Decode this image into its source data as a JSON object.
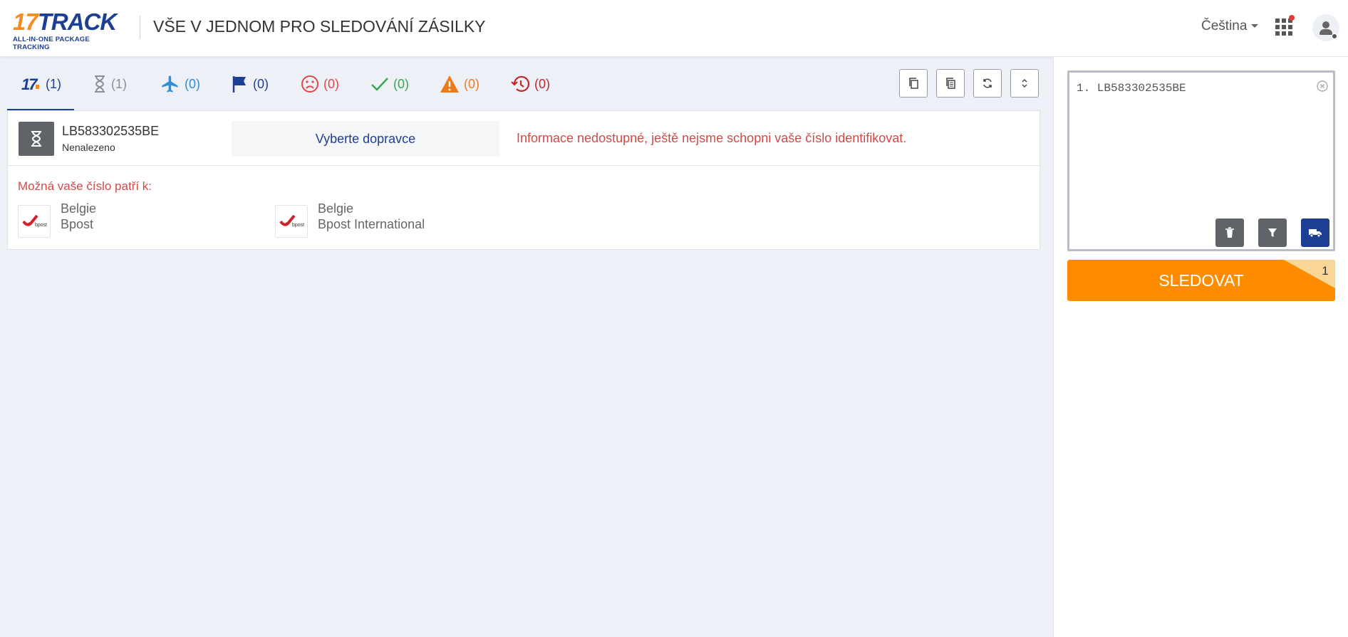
{
  "header": {
    "logo_main_num": "17",
    "logo_main_text": "TRACK",
    "logo_sub": "ALL-IN-ONE PACKAGE TRACKING",
    "title": "VŠE V JEDNOM PRO SLEDOVÁNÍ ZÁSILKY",
    "language": "Čeština"
  },
  "tabs": [
    {
      "name": "all",
      "count": "(1)",
      "color": "#1c3f94"
    },
    {
      "name": "not-found",
      "count": "(1)",
      "color": "#8a8f98"
    },
    {
      "name": "in-transit",
      "count": "(0)",
      "color": "#2f8fd8"
    },
    {
      "name": "pick-up",
      "count": "(0)",
      "color": "#1c3f94"
    },
    {
      "name": "undelivered",
      "count": "(0)",
      "color": "#e04848"
    },
    {
      "name": "delivered",
      "count": "(0)",
      "color": "#3aa551"
    },
    {
      "name": "alert",
      "count": "(0)",
      "color": "#f07a1a"
    },
    {
      "name": "expired",
      "count": "(0)",
      "color": "#c0282b"
    }
  ],
  "shipment": {
    "tracking_number": "LB583302535BE",
    "status": "Nenalezeno",
    "carrier_select_label": "Vyberte dopravce",
    "info_message": "Informace nedostupné, ještě nejsme schopni vaše číslo identifikovat.",
    "maybe_label": "Možná vaše číslo patří k:",
    "carriers": [
      {
        "country": "Belgie",
        "name": "Bpost"
      },
      {
        "country": "Belgie",
        "name": "Bpost International"
      }
    ]
  },
  "input_panel": {
    "entry_text": "1. LB583302535BE",
    "track_button_label": "SLEDOVAT",
    "track_count": "1"
  },
  "icons": {
    "tool_buttons": [
      "copy-icon",
      "copy-list-icon",
      "refresh-icon",
      "expand-collapse-icon"
    ],
    "action_buttons": [
      "trash-icon",
      "filter-icon",
      "truck-icon"
    ]
  },
  "colors": {
    "brand_blue": "#1c3f94",
    "brand_orange": "#f68b1f",
    "track_button": "#ff8c00",
    "error_text": "#d04a4a",
    "status_box": "#606368"
  }
}
